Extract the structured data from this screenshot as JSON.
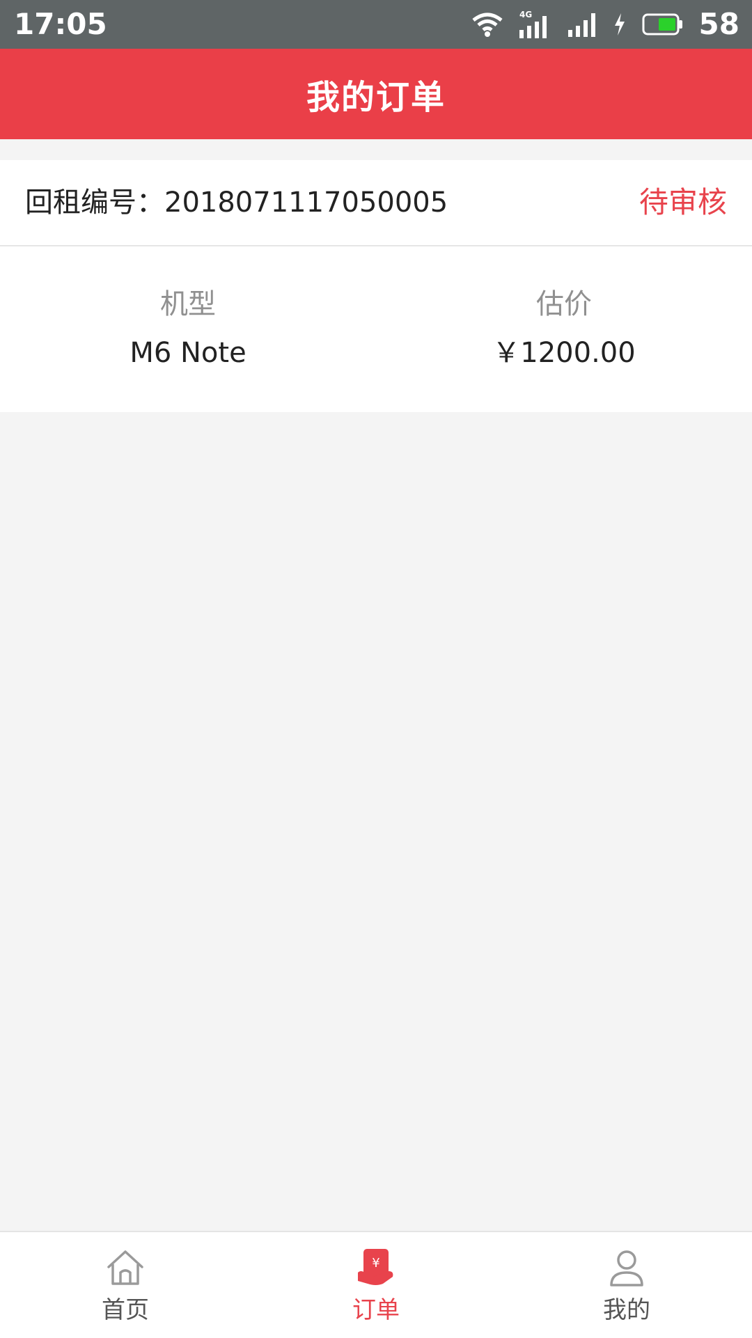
{
  "status_bar": {
    "time": "17:05",
    "network": "4G",
    "battery": "58"
  },
  "header": {
    "title": "我的订单"
  },
  "order": {
    "id_label": "回租编号：",
    "id_value": "2018071117050005",
    "status": "待审核",
    "model_label": "机型",
    "model_value": "M6 Note",
    "price_label": "估价",
    "price_value": "￥1200.00"
  },
  "tabbar": {
    "items": [
      {
        "label": "首页",
        "icon": "home-icon",
        "active": false
      },
      {
        "label": "订单",
        "icon": "order-icon",
        "active": true
      },
      {
        "label": "我的",
        "icon": "user-icon",
        "active": false
      }
    ]
  },
  "colors": {
    "accent": "#ea3f48",
    "status_bar": "#5f6566",
    "background": "#f4f4f4"
  }
}
